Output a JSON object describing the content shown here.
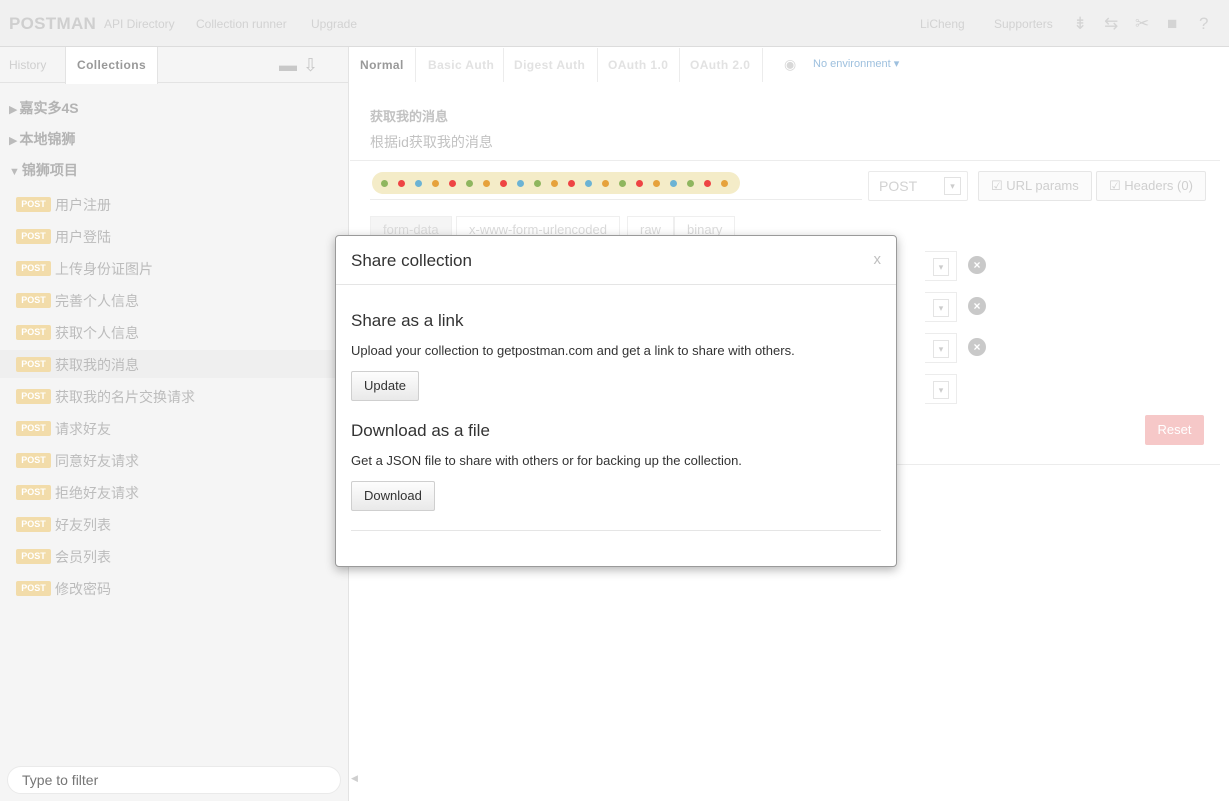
{
  "topbar": {
    "logo": "POSTMAN",
    "nav": [
      "API Directory",
      "Collection runner",
      "Upgrade"
    ],
    "user": "LiCheng",
    "supporters": "Supporters"
  },
  "sidebar": {
    "tabs": [
      "History",
      "Collections"
    ],
    "folders": [
      "嘉实多4S",
      "本地锦狮",
      "锦狮项目"
    ],
    "requests": [
      {
        "method": "POST",
        "name": "用户注册"
      },
      {
        "method": "POST",
        "name": "用户登陆"
      },
      {
        "method": "POST",
        "name": "上传身份证图片"
      },
      {
        "method": "POST",
        "name": "完善个人信息"
      },
      {
        "method": "POST",
        "name": "获取个人信息"
      },
      {
        "method": "POST",
        "name": "获取我的消息"
      },
      {
        "method": "POST",
        "name": "获取我的名片交换请求"
      },
      {
        "method": "POST",
        "name": "请求好友"
      },
      {
        "method": "POST",
        "name": "同意好友请求"
      },
      {
        "method": "POST",
        "name": "拒绝好友请求"
      },
      {
        "method": "POST",
        "name": "好友列表"
      },
      {
        "method": "POST",
        "name": "会员列表"
      },
      {
        "method": "POST",
        "name": "修改密码"
      }
    ],
    "filter_placeholder": "Type to filter"
  },
  "main": {
    "auth_tabs": [
      "Normal",
      "Basic Auth",
      "Digest Auth",
      "OAuth 1.0",
      "OAuth 2.0"
    ],
    "environment": "No environment",
    "request_title": "获取我的消息",
    "request_description": "根据id获取我的消息",
    "method": "POST",
    "url_params_label": "URL params",
    "headers_label": "Headers (0)",
    "body_tabs": [
      "form-data",
      "x-www-form-urlencoded",
      "raw",
      "binary"
    ],
    "reset_label": "Reset"
  },
  "modal": {
    "title": "Share collection",
    "close": "x",
    "link_heading": "Share as a link",
    "link_text": "Upload your collection to getpostman.com and get a link to share with others.",
    "update_label": "Update",
    "file_heading": "Download as a file",
    "file_text": "Get a JSON file to share with others or for backing up the collection.",
    "download_label": "Download"
  },
  "colors": {
    "post_badge": "#f2dcaa",
    "env_link": "#9ec0de",
    "reset": "#f6c8c8"
  }
}
